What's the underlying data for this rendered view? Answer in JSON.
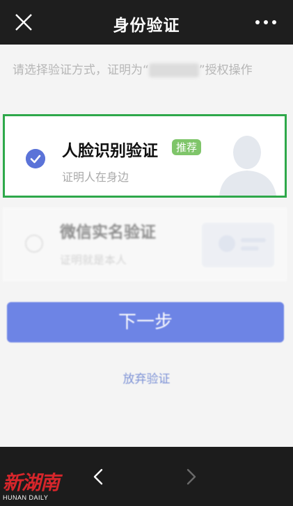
{
  "header": {
    "title": "身份验证",
    "close_icon": "close-icon",
    "more_icon": "more-icon"
  },
  "description": {
    "before": "请选择验证方式，证明为“",
    "after": "”授权操作"
  },
  "options": [
    {
      "title": "人脸识别验证",
      "badge": "推荐",
      "subtitle": "证明人在身边",
      "selected": true,
      "icon": "face-portrait-icon"
    },
    {
      "title": "微信实名验证",
      "subtitle": "证明就是本人",
      "selected": false,
      "icon": "id-card-icon"
    }
  ],
  "actions": {
    "next_label": "下一步",
    "abandon_label": "放弃验证"
  },
  "bottom_nav": {
    "back_icon": "back-arrow-icon",
    "forward_icon": "forward-arrow-icon"
  },
  "watermark": {
    "logo_text": "新湖南",
    "sub_text": "HUNAN DAILY"
  },
  "colors": {
    "accent": "#5f78e4",
    "selected_border": "#2ea84a",
    "badge": "#7fc56a",
    "watermark": "#d6262b"
  }
}
